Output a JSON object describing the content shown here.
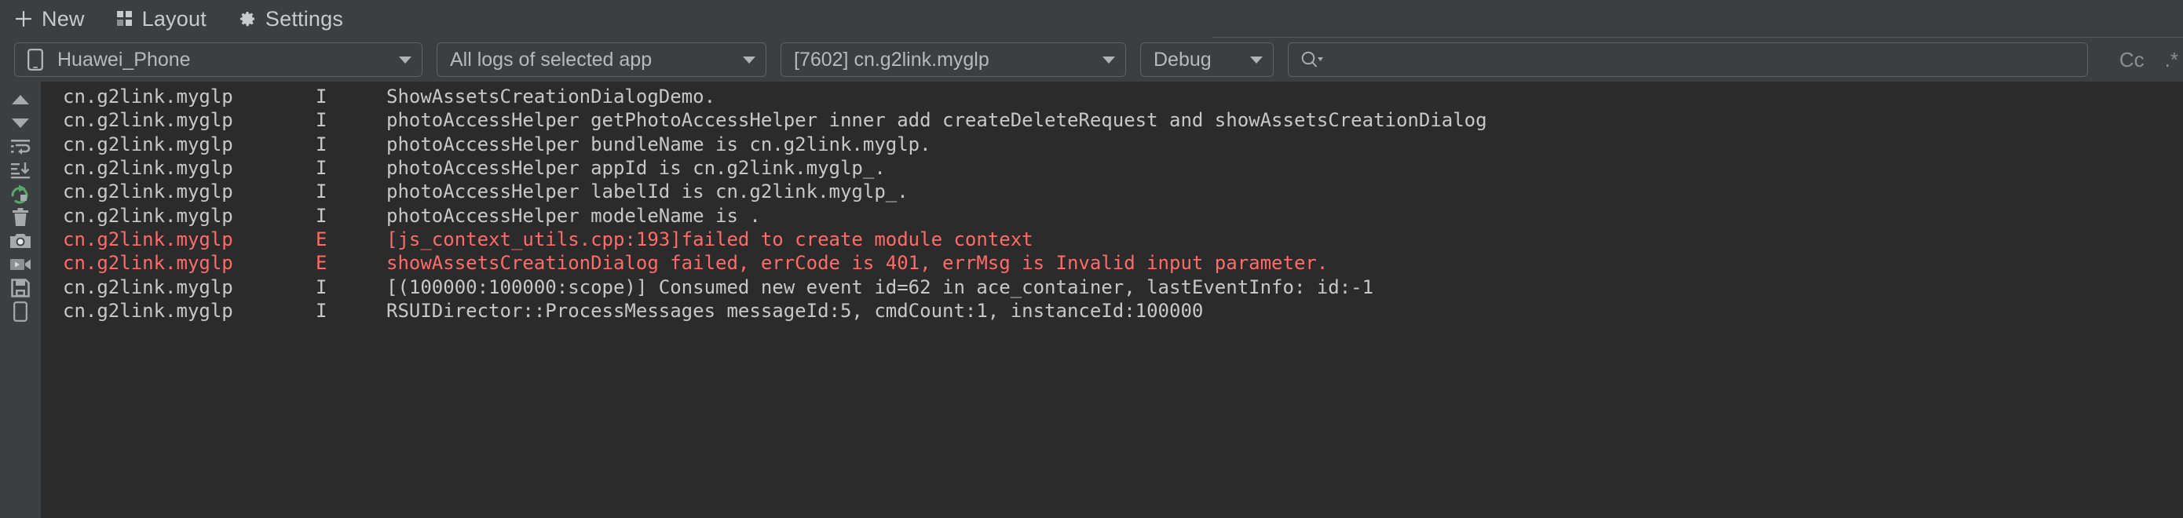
{
  "toolbar": {
    "items": [
      {
        "icon": "plus-icon",
        "label": "New"
      },
      {
        "icon": "grid-icon",
        "label": "Layout"
      },
      {
        "icon": "gear-icon",
        "label": "Settings"
      }
    ]
  },
  "filters": {
    "device": {
      "icon": "phone-icon",
      "value": "Huawei_Phone"
    },
    "log_scope": {
      "value": "All logs of selected app"
    },
    "process": {
      "value": "[7602] cn.g2link.myglp"
    },
    "level": {
      "value": "Debug"
    },
    "search": {
      "value": "",
      "placeholder": "",
      "icon": "search-icon"
    },
    "tools": [
      {
        "name": "match-case-toggle",
        "label": "Cc"
      },
      {
        "name": "regex-toggle",
        "label": ".*"
      }
    ]
  },
  "sidebar": {
    "items": [
      {
        "name": "scroll-up-icon",
        "title": "Scroll up"
      },
      {
        "name": "scroll-down-icon",
        "title": "Scroll down"
      },
      {
        "name": "soft-wrap-icon",
        "title": "Soft-wrap"
      },
      {
        "name": "scroll-to-end-icon",
        "title": "Scroll to the end"
      },
      {
        "name": "restart-icon",
        "title": "Restart",
        "color": "#59a869"
      },
      {
        "name": "trash-icon",
        "title": "Clear log"
      },
      {
        "name": "camera-icon",
        "title": "Screenshot"
      },
      {
        "name": "video-camera-icon",
        "title": "Screen record"
      },
      {
        "name": "save-icon",
        "title": "Save"
      },
      {
        "name": "device-icon",
        "title": "Device"
      }
    ]
  },
  "log": {
    "columns": [
      "tag",
      "level",
      "message"
    ],
    "lines": [
      {
        "tag": "cn.g2link.myglp",
        "level": "I",
        "message": "ShowAssetsCreationDialogDemo.",
        "severity": "info"
      },
      {
        "tag": "cn.g2link.myglp",
        "level": "I",
        "message": "photoAccessHelper getPhotoAccessHelper inner add createDeleteRequest and showAssetsCreationDialog",
        "severity": "info"
      },
      {
        "tag": "cn.g2link.myglp",
        "level": "I",
        "message": "photoAccessHelper bundleName is cn.g2link.myglp.",
        "severity": "info"
      },
      {
        "tag": "cn.g2link.myglp",
        "level": "I",
        "message": "photoAccessHelper appId is cn.g2link.myglp_.",
        "severity": "info"
      },
      {
        "tag": "cn.g2link.myglp",
        "level": "I",
        "message": "photoAccessHelper labelId is cn.g2link.myglp_.",
        "severity": "info"
      },
      {
        "tag": "cn.g2link.myglp",
        "level": "I",
        "message": "photoAccessHelper modeleName is .",
        "severity": "info"
      },
      {
        "tag": "cn.g2link.myglp",
        "level": "E",
        "message": "[js_context_utils.cpp:193]failed to create module context",
        "severity": "error"
      },
      {
        "tag": "cn.g2link.myglp",
        "level": "E",
        "message": "showAssetsCreationDialog failed, errCode is 401, errMsg is Invalid input parameter.",
        "severity": "error"
      },
      {
        "tag": "cn.g2link.myglp",
        "level": "I",
        "message": "[(100000:100000:scope)] Consumed new event id=62 in ace_container, lastEventInfo: id:-1",
        "severity": "info"
      },
      {
        "tag": "cn.g2link.myglp",
        "level": "I",
        "message": "RSUIDirector::ProcessMessages messageId:5, cmdCount:1, instanceId:100000",
        "severity": "info"
      }
    ]
  },
  "colors": {
    "error": "#ff6b68",
    "info": "#c8c8c8",
    "accent_green": "#59a869",
    "chrome": "#3c3f41",
    "log_background": "#2b2b2b"
  }
}
